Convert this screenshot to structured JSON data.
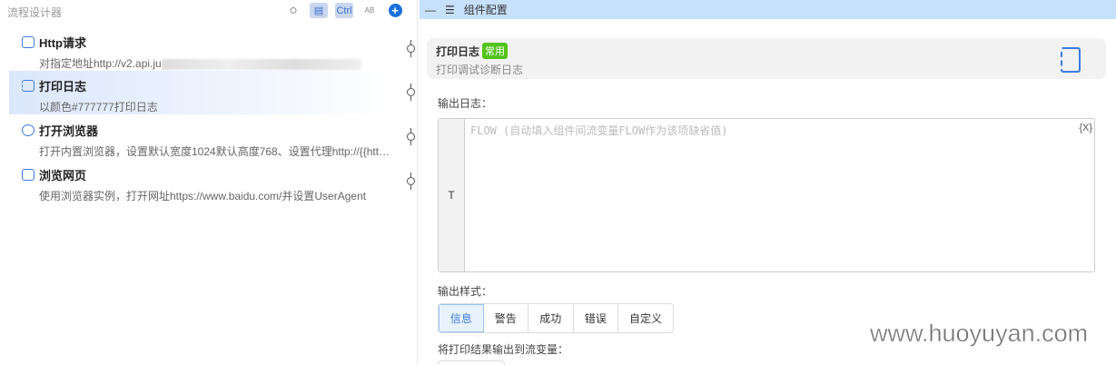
{
  "left": {
    "title": "流程设计器",
    "tools": {
      "ctrl": "Ctrl",
      "ab": "AB"
    },
    "items": [
      {
        "title": "Http请求",
        "desc": "对指定地址http://v2.api.ju",
        "icon": "http-icon"
      },
      {
        "title": "打印日志",
        "desc": "以颜色#777777打印日志",
        "icon": "log-icon"
      },
      {
        "title": "打开浏览器",
        "desc": "打开内置浏览器，设置默认宽度1024默认高度768、设置代理http://{{http…",
        "icon": "compass-icon"
      },
      {
        "title": "浏览网页",
        "desc": "使用浏览器实例，打开网址https://www.baidu.com/并设置UserAgent",
        "icon": "webpage-icon"
      }
    ]
  },
  "right": {
    "header": "组件配置",
    "card": {
      "title": "打印日志",
      "badge": "常用",
      "subtitle": "打印调试诊断日志"
    },
    "output_log_label": "输出日志：",
    "textarea": {
      "gutter": "T",
      "placeholder": "FLOW (自动填入组件间流变量FLOW作为该项缺省值)",
      "var_button": "{X}"
    },
    "style_label": "输出样式：",
    "styles": [
      "信息",
      "警告",
      "成功",
      "错误",
      "自定义"
    ],
    "selected_style": "信息",
    "save_var_label": "将打印结果输出到流变量："
  },
  "watermark": "www.huoyuyan.com",
  "colors": {
    "accent": "#3b7be0",
    "header": "#c7e0fb",
    "badge": "#52c41a"
  }
}
